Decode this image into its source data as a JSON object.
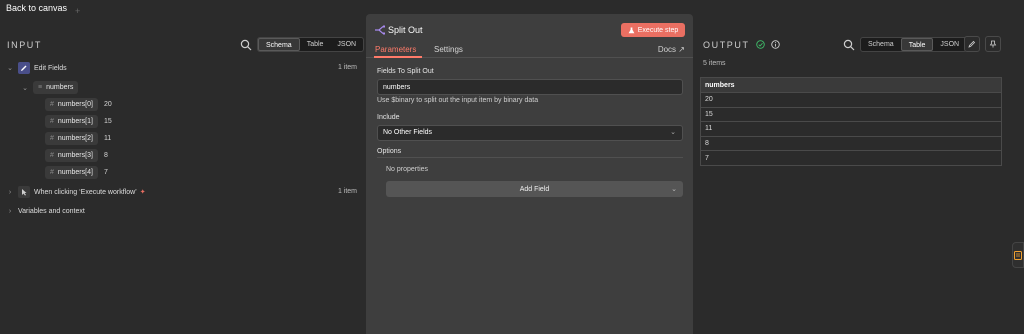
{
  "topbar": {
    "back_label": "Back to canvas"
  },
  "input": {
    "title": "INPUT",
    "tabs": [
      "Schema",
      "Table",
      "JSON"
    ],
    "active_tab": "Schema",
    "tree": {
      "edit_fields": {
        "label": "Edit Fields",
        "count": "1 item"
      },
      "numbers_label": "numbers",
      "numbers": [
        {
          "key": "numbers[0]",
          "value": "20"
        },
        {
          "key": "numbers[1]",
          "value": "15"
        },
        {
          "key": "numbers[2]",
          "value": "11"
        },
        {
          "key": "numbers[3]",
          "value": "8"
        },
        {
          "key": "numbers[4]",
          "value": "7"
        }
      ],
      "trigger": {
        "label": "When clicking ‘Execute workflow’",
        "count": "1 item"
      },
      "variables": {
        "label": "Variables and context"
      }
    }
  },
  "node": {
    "title": "Split Out",
    "execute_label": "Execute step",
    "tabs": {
      "parameters": "Parameters",
      "settings": "Settings"
    },
    "docs_label": "Docs",
    "fields_label": "Fields To Split Out",
    "fields_value": "numbers",
    "hint": "Use $binary to split out the input item by binary data",
    "include_label": "Include",
    "include_value": "No Other Fields",
    "options_label": "Options",
    "no_properties": "No properties",
    "add_field_label": "Add Field"
  },
  "output": {
    "title": "OUTPUT",
    "tabs": [
      "Schema",
      "Table",
      "JSON"
    ],
    "active_tab": "Table",
    "items_label": "5 items",
    "column": "numbers",
    "rows": [
      "20",
      "15",
      "11",
      "8",
      "7"
    ]
  },
  "colors": {
    "accent": "#ea6f62",
    "tab_active": "#ff7b6a",
    "success": "#3fbf6a"
  }
}
